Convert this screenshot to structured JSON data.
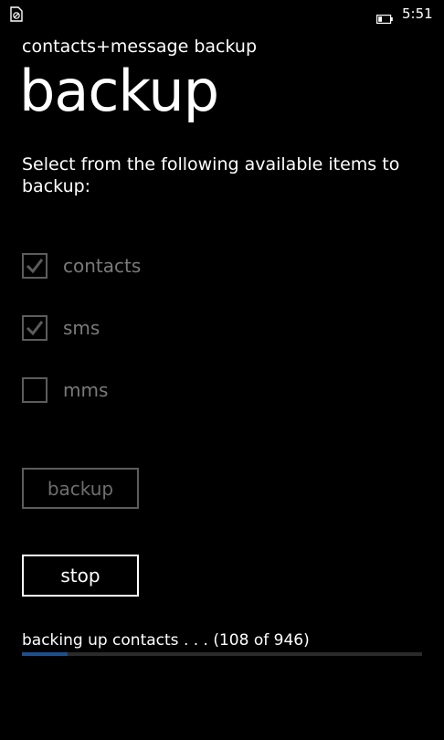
{
  "status_bar": {
    "left_icon": "no-sim-icon",
    "battery_icon": "battery-icon",
    "time": "5:51"
  },
  "app_title": "contacts+message backup",
  "page_title": "backup",
  "instructions": "Select from the following available items to backup:",
  "options": [
    {
      "label": "contacts",
      "checked": true,
      "enabled": false
    },
    {
      "label": "sms",
      "checked": true,
      "enabled": false
    },
    {
      "label": "mms",
      "checked": false,
      "enabled": false
    }
  ],
  "buttons": {
    "backup_label": "backup",
    "stop_label": "stop"
  },
  "progress": {
    "text": "backing up contacts . . . (108 of 946)",
    "value": 0.114
  },
  "colors": {
    "background": "#000000",
    "text": "#ffffff",
    "disabled": "#5c5c5c",
    "accent": "#1e4e8c"
  }
}
